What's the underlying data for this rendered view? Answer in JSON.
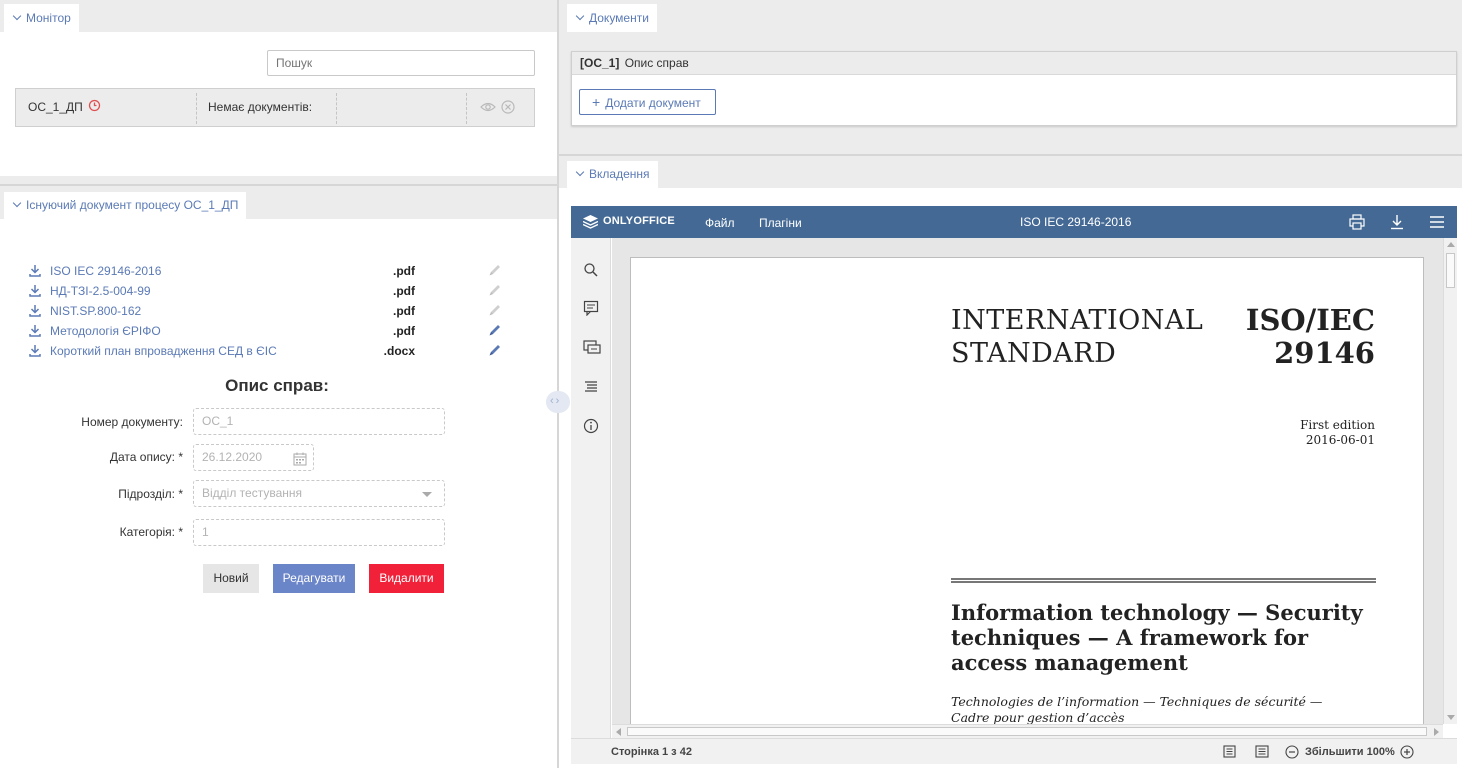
{
  "monitor": {
    "tab_label": "Монітор",
    "search_placeholder": "Пошук",
    "row": {
      "name": "ОС_1_ДП",
      "status": "Немає документів:"
    }
  },
  "existing": {
    "tab_label": "Існуючий документ процесу ОС_1_ДП",
    "files": [
      {
        "name": "ISO IEC 29146-2016",
        "ext": ".pdf",
        "editable": false
      },
      {
        "name": "НД-ТЗІ-2.5-004-99",
        "ext": ".pdf",
        "editable": false
      },
      {
        "name": "NIST.SP.800-162",
        "ext": ".pdf",
        "editable": false
      },
      {
        "name": "Методологія ЄРІФО",
        "ext": ".pdf",
        "editable": true
      },
      {
        "name": "Короткий план впровадження СЕД в ЄІС",
        "ext": ".docx",
        "editable": true
      }
    ],
    "form_title": "Опис справ:",
    "fields": {
      "doc_number_label": "Номер документу:",
      "doc_number_value": "ОС_1",
      "date_label": "Дата опису: *",
      "date_value": "26.12.2020",
      "unit_label": "Підрозділ: *",
      "unit_value": "Відділ тестування",
      "category_label": "Категорія: *",
      "category_value": "1"
    },
    "buttons": {
      "new": "Новий",
      "edit": "Редагувати",
      "delete": "Видалити"
    }
  },
  "documents": {
    "tab_label": "Документи",
    "card_code": "[ОС_1]",
    "card_title": "Опис справ",
    "add_button": "Додати документ"
  },
  "attachments": {
    "tab_label": "Вкладення",
    "editor": {
      "logo": "ONLYOFFICE",
      "menu_file": "Файл",
      "menu_plugins": "Плагіни",
      "doc_title": "ISO IEC 29146-2016",
      "page_status": "Сторінка 1 з 42",
      "zoom_label": "Збільшити 100%"
    },
    "document": {
      "heading_left_1": "INTERNATIONAL",
      "heading_left_2": "STANDARD",
      "heading_right_1": "ISO/IEC",
      "heading_right_2": "29146",
      "edition": "First edition",
      "date": "2016-06-01",
      "title": "Information technology — Security techniques — A framework for access management",
      "subtitle": "Technologies de l’information — Techniques de sécurité — Cadre pour gestion d’accès"
    }
  },
  "colors": {
    "link": "#5b7ab5",
    "primary_button": "#6b85c9",
    "danger_button": "#f2213a",
    "editor_header": "#446995",
    "clock_icon": "#e05050"
  }
}
